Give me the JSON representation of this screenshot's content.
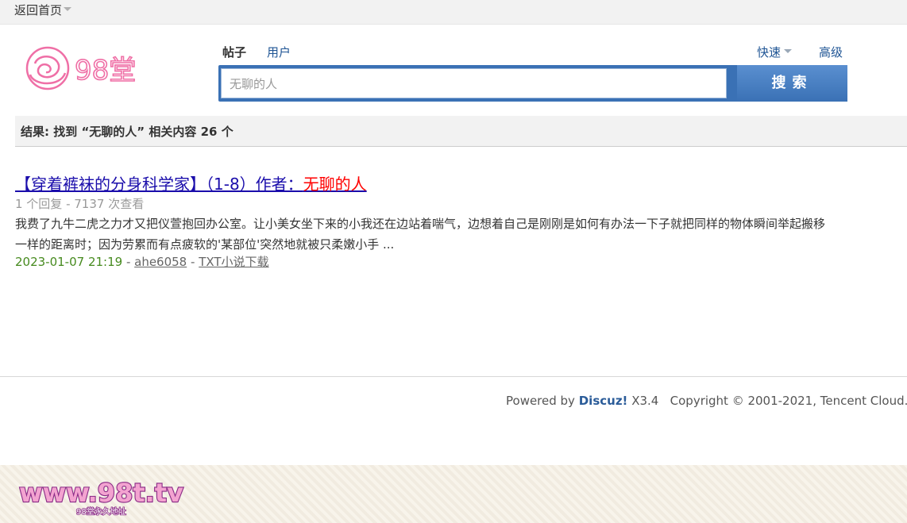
{
  "topbar": {
    "back_label": "返回首页"
  },
  "logo": {
    "text": "98堂"
  },
  "search": {
    "types": [
      "帖子",
      "用户"
    ],
    "quick_label": "快速",
    "advanced_label": "高级",
    "value": "无聊的人",
    "button_label": "搜索"
  },
  "results": {
    "summary": "结果: 找到 “无聊的人” 相关内容 26 个",
    "items": [
      {
        "title_prefix": "【穿着裤袜的分身科学家】（1-8）作者：",
        "title_highlight": "无聊的人",
        "meta": "1 个回复 - 7137 次查看",
        "description": "我费了九牛二虎之力才又把仪萱抱回办公室。让小美女坐下来的小我还在边站着喘气，边想着自己是刚刚是如何有办法一下子就把同样的物体瞬间举起搬移一样的距离时；因为劳累而有点疲软的'某部位'突然地就被只柔嫩小手 ...",
        "date": "2023-01-07 21:19",
        "author": "ahe6058",
        "forum": "TXT小说下载"
      }
    ]
  },
  "footer": {
    "powered_prefix": "Powered by",
    "powered_brand": "Discuz!",
    "version": "X3.4",
    "copyright": "Copyright © 2001-2021, Tencent Cloud.",
    "separator": "|"
  },
  "banner": {
    "site": "www.98t.tv",
    "tagline": "98堂永久地址"
  },
  "colors": {
    "accent": "#3a71b5",
    "link": "#1e5494",
    "highlight": "#ff0000",
    "date": "#468a1e"
  }
}
